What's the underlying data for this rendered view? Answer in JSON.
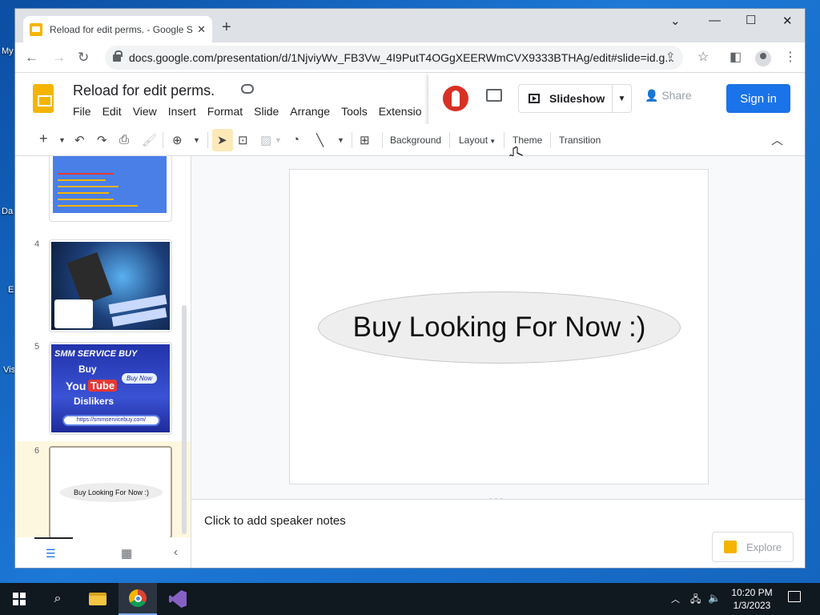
{
  "desktop": {
    "icons": [
      "My",
      "Da",
      "E",
      "Vis"
    ]
  },
  "browser": {
    "tab_title": "Reload for edit perms. - Google S",
    "url": "docs.google.com/presentation/d/1NjviyWv_FB3Vw_4I9PutT4OGgXEERWmCVX9333BTHAg/edit#slide=id.g..."
  },
  "app": {
    "doc_title": "Reload for edit perms.",
    "menus": [
      "File",
      "Edit",
      "View",
      "Insert",
      "Format",
      "Slide",
      "Arrange",
      "Tools",
      "Extensio"
    ],
    "slideshow_label": "Slideshow",
    "share_label": "Share",
    "signin_label": "Sign in"
  },
  "toolbar": {
    "background_label": "Background",
    "layout_label": "Layout",
    "theme_label": "Theme",
    "transition_label": "Transition"
  },
  "filmstrip": {
    "slides": [
      {
        "number": "4"
      },
      {
        "number": "5",
        "brand": "SMM SERVICE BUY",
        "line1": "Buy",
        "you": "You",
        "tube": "Tube",
        "line3": "Dislikers",
        "url": "https://smmservicebuy.com/",
        "badge": "Buy Now"
      },
      {
        "number": "6",
        "text": "Buy Looking For Now :)"
      }
    ]
  },
  "slide": {
    "text": "Buy Looking For Now :)"
  },
  "notes": {
    "placeholder": "Click to add speaker notes"
  },
  "explore_label": "Explore",
  "taskbar": {
    "time": "10:20 PM",
    "date": "1/3/2023"
  }
}
